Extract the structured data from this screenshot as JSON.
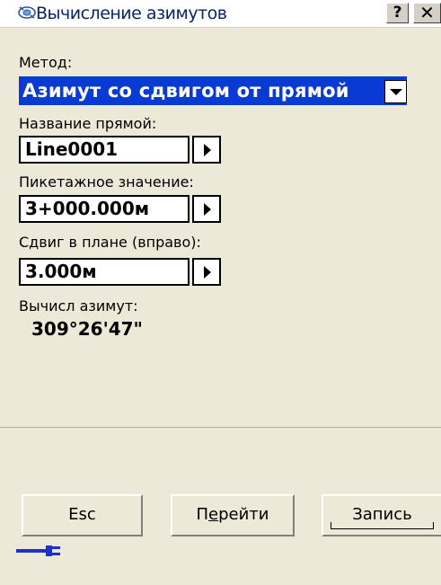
{
  "window": {
    "title": "Вычисление азимутов",
    "help_label": "?",
    "close_label": "✕"
  },
  "form": {
    "method_label": "Метод:",
    "method_value": "Азимут со сдвигом от прямой",
    "line_name_label": "Название прямой:",
    "line_name_value": "Line0001",
    "station_label": "Пикетажное значение:",
    "station_value": "3+000.000м",
    "offset_label": "Сдвиг в плане (вправо):",
    "offset_value": "3.000м",
    "azimuth_label": "Вычисл азимут:",
    "azimuth_value": "309°26'47\""
  },
  "buttons": {
    "esc_label": "Esc",
    "goto_label_pre": "П",
    "goto_label_underlined": "е",
    "goto_label_post": "рейти",
    "save_label": "Запись"
  },
  "colors": {
    "accent_select": "#0a3ad4",
    "title_text": "#0a246a",
    "power_icon": "#1f2fd6"
  },
  "icons": {
    "app": "satellite-icon",
    "dropdown": "chevron-down-icon",
    "arrow": "arrow-right-icon",
    "status": "power-plug-icon"
  }
}
